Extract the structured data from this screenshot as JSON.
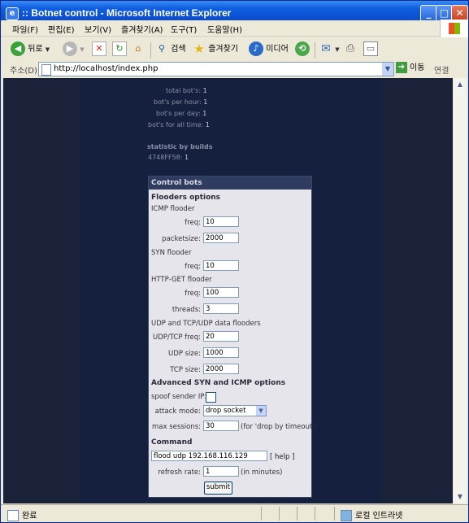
{
  "window": {
    "title": ":: Botnet control - Microsoft Internet Explorer",
    "min_glyph": "_",
    "max_glyph": "□",
    "close_glyph": "✕"
  },
  "menu": [
    "파일(F)",
    "편집(E)",
    "보기(V)",
    "즐겨찾기(A)",
    "도구(T)",
    "도움말(H)"
  ],
  "toolbar": {
    "back_label": "뒤로",
    "search_label": "검색",
    "favorites_label": "즐겨찾기",
    "media_label": "미디어"
  },
  "address": {
    "label": "주소(D)",
    "url": "http://localhost/index.php",
    "go_label": "이동",
    "links_label": "연결"
  },
  "stats": [
    {
      "label": "total bot's:",
      "value": "1"
    },
    {
      "label": "bot's per hour:",
      "value": "1"
    },
    {
      "label": "bot's per day:",
      "value": "1"
    },
    {
      "label": "bot's for all time:",
      "value": "1"
    }
  ],
  "builds": {
    "heading": "statistic by builds",
    "items": [
      {
        "label": "4748FF58:",
        "value": "1"
      }
    ]
  },
  "control": {
    "header": "Control bots",
    "floaders_heading": "Flooders options",
    "icmp": {
      "heading": "ICMP flooder",
      "freq_label": "freq:",
      "freq_value": "10",
      "packetsize_label": "packetsize:",
      "packetsize_value": "2000"
    },
    "syn": {
      "heading": "SYN flooder",
      "freq_label": "freq:",
      "freq_value": "10"
    },
    "httpget": {
      "heading": "HTTP-GET flooder",
      "freq_label": "freq:",
      "freq_value": "100",
      "threads_label": "threads:",
      "threads_value": "3"
    },
    "udp": {
      "heading": "UDP and TCP/UDP data flooders",
      "freq_label": "UDP/TCP freq:",
      "freq_value": "20",
      "udpsize_label": "UDP size:",
      "udpsize_value": "1000",
      "tcpsize_label": "TCP size:",
      "tcpsize_value": "2000"
    },
    "advanced": {
      "heading": "Advanced SYN and ICMP options",
      "spoof_label": "spoof sender IP:",
      "spoof_checked": false,
      "attack_label": "attack mode:",
      "attack_value": "drop socket",
      "maxsess_label": "max sessions:",
      "maxsess_value": "30",
      "maxsess_note": "(for 'drop by timeout')"
    },
    "command": {
      "heading": "Command",
      "value": "flood udp 192.168.116.129",
      "help_label": "[ help ]",
      "refresh_label": "refresh rate:",
      "refresh_value": "1",
      "refresh_note": "(in minutes)",
      "submit_label": "submit"
    }
  },
  "status": {
    "left": "완료",
    "zone": "로컬 인트라넷"
  },
  "colors": {
    "page_bg": "#1a223a",
    "panel_bg": "#e7e5ec",
    "panel_header": "#2f3b5f",
    "stat_text": "#8a90a4",
    "titlebar": "#0b4fd1"
  }
}
